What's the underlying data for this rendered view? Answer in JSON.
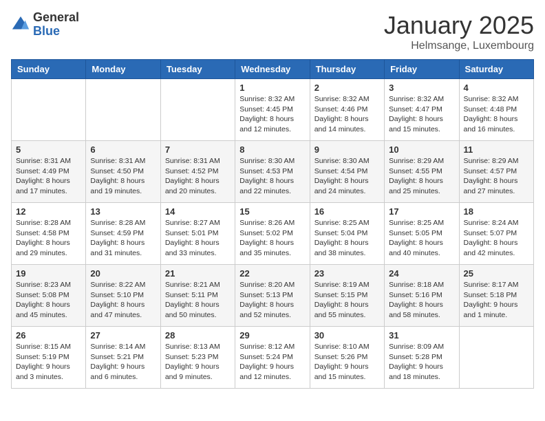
{
  "logo": {
    "general": "General",
    "blue": "Blue"
  },
  "header": {
    "title": "January 2025",
    "location": "Helmsange, Luxembourg"
  },
  "weekdays": [
    "Sunday",
    "Monday",
    "Tuesday",
    "Wednesday",
    "Thursday",
    "Friday",
    "Saturday"
  ],
  "weeks": [
    [
      {
        "day": "",
        "info": ""
      },
      {
        "day": "",
        "info": ""
      },
      {
        "day": "",
        "info": ""
      },
      {
        "day": "1",
        "info": "Sunrise: 8:32 AM\nSunset: 4:45 PM\nDaylight: 8 hours\nand 12 minutes."
      },
      {
        "day": "2",
        "info": "Sunrise: 8:32 AM\nSunset: 4:46 PM\nDaylight: 8 hours\nand 14 minutes."
      },
      {
        "day": "3",
        "info": "Sunrise: 8:32 AM\nSunset: 4:47 PM\nDaylight: 8 hours\nand 15 minutes."
      },
      {
        "day": "4",
        "info": "Sunrise: 8:32 AM\nSunset: 4:48 PM\nDaylight: 8 hours\nand 16 minutes."
      }
    ],
    [
      {
        "day": "5",
        "info": "Sunrise: 8:31 AM\nSunset: 4:49 PM\nDaylight: 8 hours\nand 17 minutes."
      },
      {
        "day": "6",
        "info": "Sunrise: 8:31 AM\nSunset: 4:50 PM\nDaylight: 8 hours\nand 19 minutes."
      },
      {
        "day": "7",
        "info": "Sunrise: 8:31 AM\nSunset: 4:52 PM\nDaylight: 8 hours\nand 20 minutes."
      },
      {
        "day": "8",
        "info": "Sunrise: 8:30 AM\nSunset: 4:53 PM\nDaylight: 8 hours\nand 22 minutes."
      },
      {
        "day": "9",
        "info": "Sunrise: 8:30 AM\nSunset: 4:54 PM\nDaylight: 8 hours\nand 24 minutes."
      },
      {
        "day": "10",
        "info": "Sunrise: 8:29 AM\nSunset: 4:55 PM\nDaylight: 8 hours\nand 25 minutes."
      },
      {
        "day": "11",
        "info": "Sunrise: 8:29 AM\nSunset: 4:57 PM\nDaylight: 8 hours\nand 27 minutes."
      }
    ],
    [
      {
        "day": "12",
        "info": "Sunrise: 8:28 AM\nSunset: 4:58 PM\nDaylight: 8 hours\nand 29 minutes."
      },
      {
        "day": "13",
        "info": "Sunrise: 8:28 AM\nSunset: 4:59 PM\nDaylight: 8 hours\nand 31 minutes."
      },
      {
        "day": "14",
        "info": "Sunrise: 8:27 AM\nSunset: 5:01 PM\nDaylight: 8 hours\nand 33 minutes."
      },
      {
        "day": "15",
        "info": "Sunrise: 8:26 AM\nSunset: 5:02 PM\nDaylight: 8 hours\nand 35 minutes."
      },
      {
        "day": "16",
        "info": "Sunrise: 8:25 AM\nSunset: 5:04 PM\nDaylight: 8 hours\nand 38 minutes."
      },
      {
        "day": "17",
        "info": "Sunrise: 8:25 AM\nSunset: 5:05 PM\nDaylight: 8 hours\nand 40 minutes."
      },
      {
        "day": "18",
        "info": "Sunrise: 8:24 AM\nSunset: 5:07 PM\nDaylight: 8 hours\nand 42 minutes."
      }
    ],
    [
      {
        "day": "19",
        "info": "Sunrise: 8:23 AM\nSunset: 5:08 PM\nDaylight: 8 hours\nand 45 minutes."
      },
      {
        "day": "20",
        "info": "Sunrise: 8:22 AM\nSunset: 5:10 PM\nDaylight: 8 hours\nand 47 minutes."
      },
      {
        "day": "21",
        "info": "Sunrise: 8:21 AM\nSunset: 5:11 PM\nDaylight: 8 hours\nand 50 minutes."
      },
      {
        "day": "22",
        "info": "Sunrise: 8:20 AM\nSunset: 5:13 PM\nDaylight: 8 hours\nand 52 minutes."
      },
      {
        "day": "23",
        "info": "Sunrise: 8:19 AM\nSunset: 5:15 PM\nDaylight: 8 hours\nand 55 minutes."
      },
      {
        "day": "24",
        "info": "Sunrise: 8:18 AM\nSunset: 5:16 PM\nDaylight: 8 hours\nand 58 minutes."
      },
      {
        "day": "25",
        "info": "Sunrise: 8:17 AM\nSunset: 5:18 PM\nDaylight: 9 hours\nand 1 minute."
      }
    ],
    [
      {
        "day": "26",
        "info": "Sunrise: 8:15 AM\nSunset: 5:19 PM\nDaylight: 9 hours\nand 3 minutes."
      },
      {
        "day": "27",
        "info": "Sunrise: 8:14 AM\nSunset: 5:21 PM\nDaylight: 9 hours\nand 6 minutes."
      },
      {
        "day": "28",
        "info": "Sunrise: 8:13 AM\nSunset: 5:23 PM\nDaylight: 9 hours\nand 9 minutes."
      },
      {
        "day": "29",
        "info": "Sunrise: 8:12 AM\nSunset: 5:24 PM\nDaylight: 9 hours\nand 12 minutes."
      },
      {
        "day": "30",
        "info": "Sunrise: 8:10 AM\nSunset: 5:26 PM\nDaylight: 9 hours\nand 15 minutes."
      },
      {
        "day": "31",
        "info": "Sunrise: 8:09 AM\nSunset: 5:28 PM\nDaylight: 9 hours\nand 18 minutes."
      },
      {
        "day": "",
        "info": ""
      }
    ]
  ]
}
